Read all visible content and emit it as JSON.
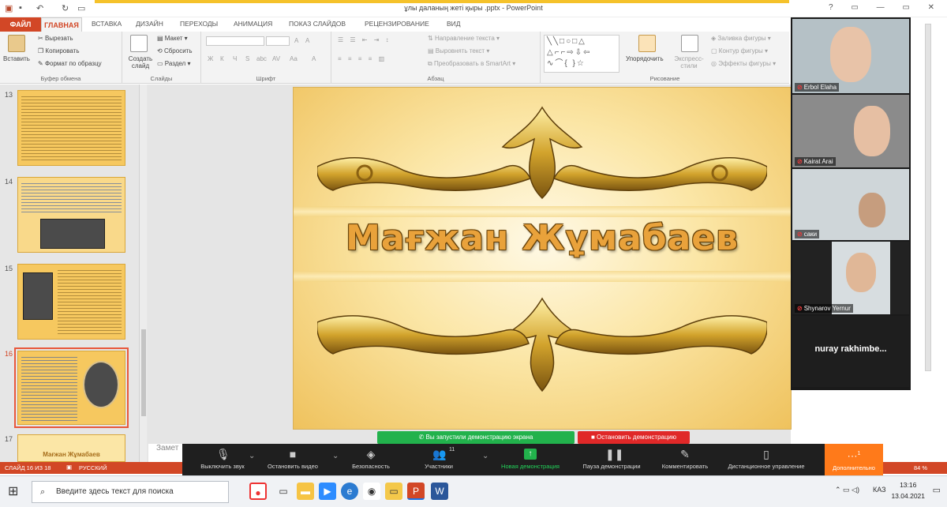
{
  "titlebar": {
    "doc_title": "ұлы даланың жеті қыры .pptx - PowerPoint",
    "window_controls": "? ▭ — ▭ ✕"
  },
  "tabs": {
    "file": "ФАЙЛ",
    "home": "ГЛАВНАЯ",
    "items": [
      "ВСТАВКА",
      "ДИЗАЙН",
      "ПЕРЕХОДЫ",
      "АНИМАЦИЯ",
      "ПОКАЗ СЛАЙДОВ",
      "РЕЦЕНЗИРОВАНИЕ",
      "ВИД"
    ]
  },
  "ribbon": {
    "clipboard": {
      "paste": "Вставить",
      "cut": "Вырезать",
      "copy": "Копировать",
      "format_painter": "Формат по образцу",
      "label": "Буфер обмена"
    },
    "slides": {
      "new_slide": "Создать слайд",
      "layout": "Макет",
      "reset": "Сбросить",
      "section": "Раздел",
      "label": "Слайды"
    },
    "font": {
      "label": "Шрифт",
      "bold": "Ж",
      "italic": "К",
      "underline": "Ч",
      "strike": "S",
      "abc": "abc",
      "spacing": "AV",
      "case": "Aa",
      "color": "A",
      "grow": "A",
      "shrink": "A"
    },
    "paragraph": {
      "text_direction": "Направление текста",
      "align_text": "Выровнять текст",
      "smartart": "Преобразовать в SmartArt",
      "label": "Абзац"
    },
    "drawing": {
      "arrange": "Упорядочить",
      "quick_styles": "Экспресс-стили",
      "shape_fill": "Заливка фигуры",
      "shape_outline": "Контур фигуры",
      "shape_effects": "Эффекты фигуры",
      "label": "Рисование"
    }
  },
  "thumbnails": [
    {
      "num": "13"
    },
    {
      "num": "14"
    },
    {
      "num": "15"
    },
    {
      "num": "16",
      "selected": true
    },
    {
      "num": "17",
      "text": "Мағжан Жұмабаев"
    }
  ],
  "slide": {
    "title": "Мағжан Жұмабаев"
  },
  "notes": {
    "placeholder": "Замет"
  },
  "participants": [
    {
      "name": "Erbol Elaha"
    },
    {
      "name": "Kairat Arai"
    },
    {
      "name": "cаки"
    },
    {
      "name": "Shynarov Yernur"
    },
    {
      "name": "nuray  rakhimbe..."
    }
  ],
  "share": {
    "status": "Вы запустили демонстрацию экрана",
    "stop": "Остановить демонстрацию"
  },
  "zoombar": {
    "mute": "Выключить звук",
    "video": "Остановить видео",
    "security": "Безопасность",
    "participants": "Участники",
    "participants_count": "11",
    "new_share": "Новая демонстрация",
    "pause_share": "Пауза демонстрации",
    "annotate": "Комментировать",
    "remote_control": "Дистанционное управление",
    "more": "Дополнительно",
    "more_badge": "1"
  },
  "statusbar": {
    "slide_info": "СЛАЙД 16 ИЗ 18",
    "language": "РУССКИЙ",
    "zoom": "84 %"
  },
  "taskbar": {
    "search_placeholder": "Введите здесь текст для поиска",
    "lang": "КАЗ",
    "time": "13:16",
    "date": "13.04.2021"
  },
  "colors": {
    "accent": "#d24726",
    "share_green": "#22b24c",
    "stop_red": "#e02828",
    "zoom_orange": "#ff7a1a"
  }
}
